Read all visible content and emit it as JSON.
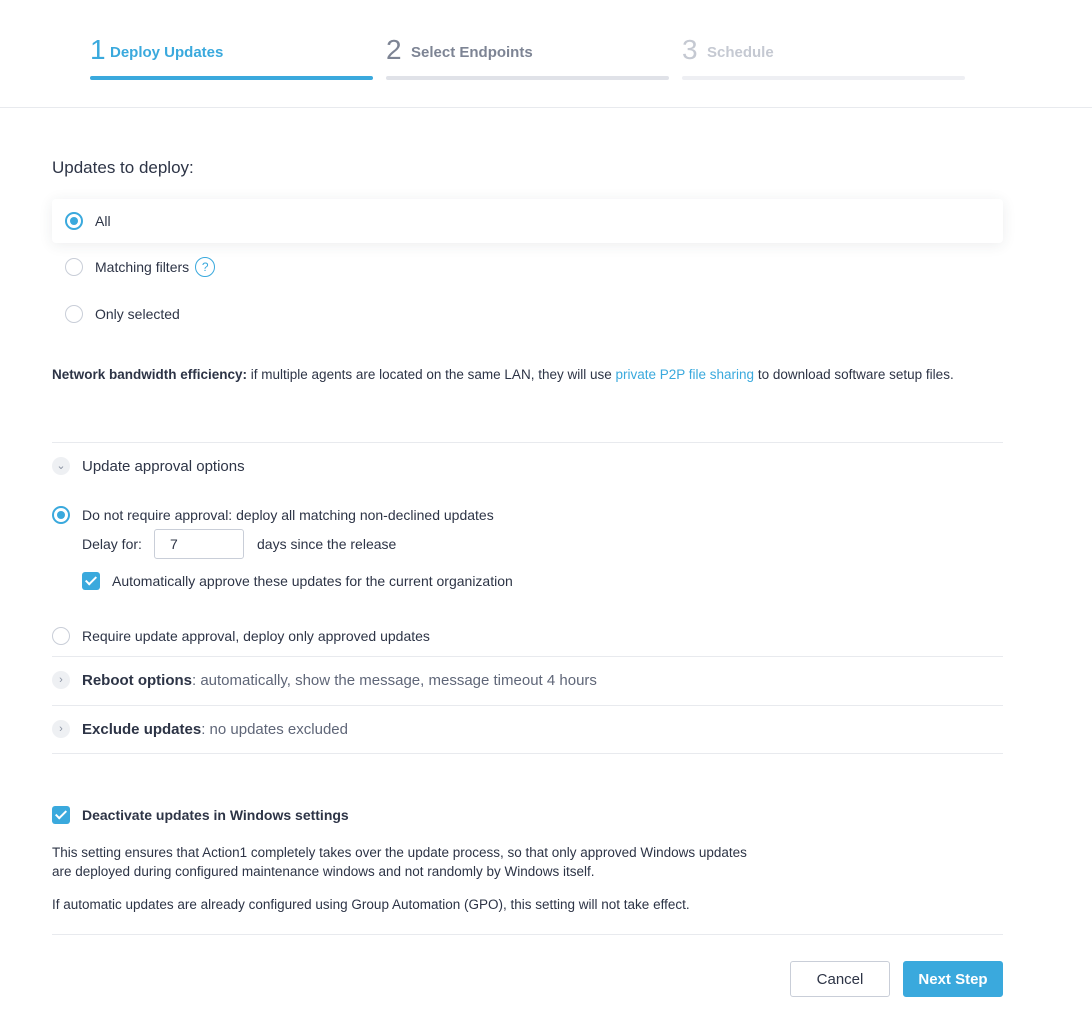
{
  "steps": [
    {
      "number": "1",
      "label": "Deploy Updates"
    },
    {
      "number": "2",
      "label": "Select Endpoints"
    },
    {
      "number": "3",
      "label": "Schedule"
    }
  ],
  "updates_to_deploy": {
    "title": "Updates to deploy:",
    "options": [
      {
        "label": "All",
        "selected": true
      },
      {
        "label": "Matching filters",
        "selected": false,
        "help": "?"
      },
      {
        "label": "Only selected",
        "selected": false
      }
    ]
  },
  "network": {
    "bold": "Network bandwidth efficiency:",
    "text_before": " if multiple agents are located on the same LAN, they will use ",
    "link": "private P2P file sharing",
    "text_after": " to download software setup files."
  },
  "approval": {
    "title": "Update approval options",
    "option_no_approval": "Do not require approval: deploy all matching non-declined updates",
    "delay_label": "Delay for:",
    "delay_value": "7",
    "delay_suffix": "days since the release",
    "auto_approve": "Automatically approve these updates for the current organization",
    "option_require": "Require update approval, deploy only approved updates"
  },
  "reboot": {
    "title": "Reboot options",
    "summary": ": automatically, show the message, message timeout 4 hours"
  },
  "exclude": {
    "title": "Exclude updates",
    "summary": ": no updates excluded"
  },
  "deactivate": {
    "label": "Deactivate updates in Windows settings",
    "checked": true,
    "paragraph1_line1": "This setting ensures that Action1 completely takes over the update process, so that only approved Windows updates",
    "paragraph1_line2": "are deployed during configured maintenance windows and not randomly by Windows itself.",
    "paragraph2": "If automatic updates are already configured using Group Automation (GPO), this setting will not take effect."
  },
  "buttons": {
    "cancel": "Cancel",
    "next": "Next Step"
  },
  "colors": {
    "accent": "#3aa9dd",
    "text": "#2d3446"
  }
}
